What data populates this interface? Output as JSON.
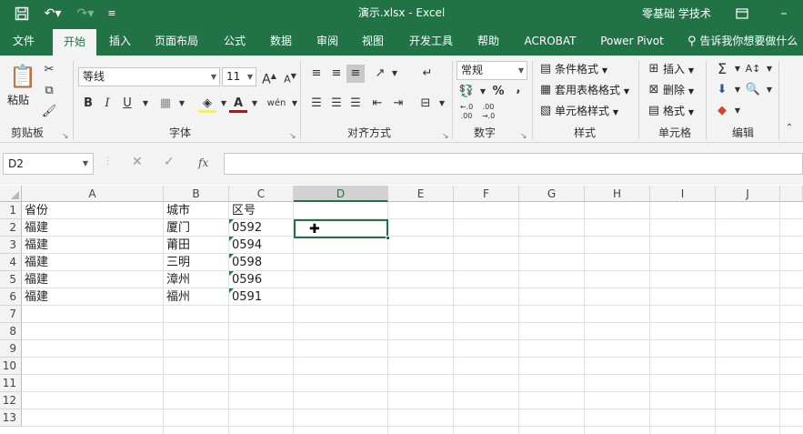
{
  "window": {
    "title": "演示.xlsx  -  Excel",
    "user": "零基础 学技术"
  },
  "tabs": [
    "文件",
    "开始",
    "插入",
    "页面布局",
    "公式",
    "数据",
    "审阅",
    "视图",
    "开发工具",
    "帮助",
    "ACROBAT",
    "Power Pivot"
  ],
  "active_tab": "开始",
  "tell_me": "告诉我你想要做什么",
  "ribbon": {
    "clipboard": {
      "paste": "粘贴",
      "group": "剪贴板"
    },
    "font": {
      "name": "等线",
      "size": "11",
      "bold": "B",
      "italic": "I",
      "underline": "U",
      "phonetic": "wén",
      "group": "字体"
    },
    "alignment": {
      "group": "对齐方式"
    },
    "number": {
      "format": "常规",
      "percent": "%",
      "comma": ",",
      "group": "数字"
    },
    "styles": {
      "conditional": "条件格式",
      "table": "套用表格格式",
      "cell": "单元格样式",
      "group": "样式"
    },
    "cells": {
      "insert": "插入",
      "delete": "删除",
      "format": "格式",
      "group": "单元格"
    },
    "editing": {
      "group": "编辑"
    }
  },
  "formula_bar": {
    "name_box": "D2",
    "formula": ""
  },
  "columns": [
    "A",
    "B",
    "C",
    "D",
    "E",
    "F",
    "G",
    "H",
    "I",
    "J"
  ],
  "selected_column": "D",
  "rows": [
    "1",
    "2",
    "3",
    "4",
    "5",
    "6",
    "7",
    "8",
    "9",
    "10",
    "11",
    "12",
    "13"
  ],
  "cells": {
    "header": [
      "省份",
      "城市",
      "区号"
    ],
    "data": [
      [
        "福建",
        "厦门",
        "0592"
      ],
      [
        "福建",
        "莆田",
        "0594"
      ],
      [
        "福建",
        "三明",
        "0598"
      ],
      [
        "福建",
        "漳州",
        "0596"
      ],
      [
        "福建",
        "福州",
        "0591"
      ]
    ]
  },
  "accent_color": "#217346"
}
